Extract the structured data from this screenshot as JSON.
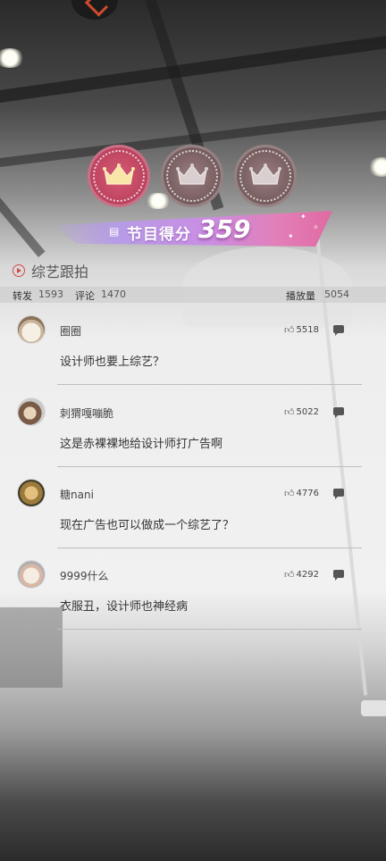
{
  "score": {
    "label": "节目得分",
    "value": "359",
    "crowns_filled": 1,
    "crowns_total": 3
  },
  "section": {
    "title": "综艺跟拍"
  },
  "stats": {
    "forward_label": "转发",
    "forward_count": "1593",
    "comment_label": "评论",
    "comment_count": "1470",
    "play_label": "播放量",
    "play_count": "5054"
  },
  "comments": [
    {
      "user": "圈圈",
      "likes": "5518",
      "text": "设计师也要上综艺？",
      "avatar": "cat-avatar"
    },
    {
      "user": "刺猬嘎嘣脆",
      "likes": "5022",
      "text": "这是赤裸裸地给设计师打广告啊",
      "avatar": "hedgehog-avatar"
    },
    {
      "user": "糖nani",
      "likes": "4776",
      "text": "现在广告也可以做成一个综艺了？",
      "avatar": "dog-avatar"
    },
    {
      "user": "9999什么",
      "likes": "4292",
      "text": "衣服丑，设计师也神经病",
      "avatar": "pet-avatar"
    }
  ],
  "colors": {
    "accent": "#d44a4a",
    "crown_active": "#b8405c",
    "crown_inactive": "#6e5556",
    "banner_start": "#b69ce6",
    "banner_end": "#e06aa2"
  },
  "icons": {
    "like": "thumbs-up-icon",
    "reply": "comment-bubble-icon",
    "play": "play-circle-icon",
    "crown": "crown-icon"
  }
}
